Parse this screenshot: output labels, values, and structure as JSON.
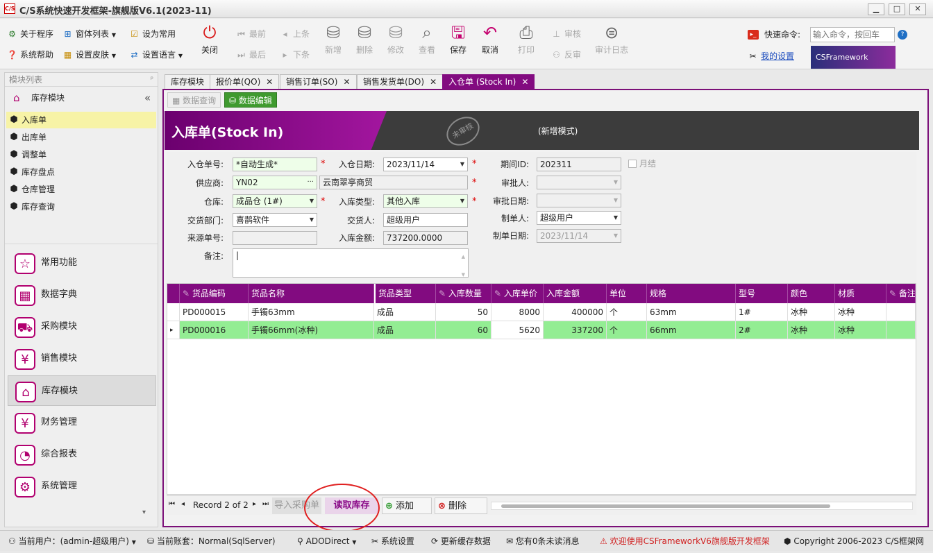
{
  "window": {
    "icon_text": "C/S",
    "title": "C/S系统快速开发框架-旗舰版V6.1(2023-11)",
    "min": "▁",
    "max": "□",
    "close": "✕"
  },
  "ribbon": {
    "about": "关于程序",
    "window_list": "窗体列表",
    "set_common": "设为常用",
    "help": "系统帮助",
    "skin": "设置皮肤",
    "language": "设置语言",
    "close": "关闭",
    "first": "最前",
    "prev": "上条",
    "last": "最后",
    "next": "下条",
    "add": "新增",
    "delete": "删除",
    "edit": "修改",
    "view": "查看",
    "save": "保存",
    "cancel": "取消",
    "print": "打印",
    "approve": "审核",
    "unapprove": "反审",
    "audit_log": "审计日志",
    "quick_cmd_label": "快速命令:",
    "quick_cmd_placeholder": "输入命令，按回车",
    "my_settings": "我的设置",
    "brand": "CSFramework"
  },
  "left": {
    "header": "模块列表",
    "pin": "ᵖ",
    "module_title": "库存模块",
    "collapse": "«",
    "tree": [
      "入库单",
      "出库单",
      "调整单",
      "库存盘点",
      "仓库管理",
      "库存查询"
    ],
    "nav": [
      {
        "label": "常用功能",
        "icon": "☆"
      },
      {
        "label": "数据字典",
        "icon": "▦"
      },
      {
        "label": "采购模块",
        "icon": "⛟"
      },
      {
        "label": "销售模块",
        "icon": "¥"
      },
      {
        "label": "库存模块",
        "icon": "⌂"
      },
      {
        "label": "财务管理",
        "icon": "¥"
      },
      {
        "label": "综合报表",
        "icon": "◔"
      },
      {
        "label": "系统管理",
        "icon": "⚙"
      }
    ],
    "scroll_down": "▾"
  },
  "tabs": [
    {
      "label": "库存模块",
      "close": ""
    },
    {
      "label": "报价单(QO)",
      "close": "✕"
    },
    {
      "label": "销售订单(SO)",
      "close": "✕"
    },
    {
      "label": "销售发货单(DO)",
      "close": "✕"
    },
    {
      "label": "入仓单 (Stock In)",
      "close": "✕"
    }
  ],
  "subtabs": {
    "query": "数据查询",
    "edit": "数据编辑"
  },
  "header": {
    "title": "入库单(Stock In)",
    "stamp": "未审核",
    "mode": "(新增模式)"
  },
  "form": {
    "order_no_label": "入仓单号:",
    "order_no": "*自动生成*",
    "date_label": "入仓日期:",
    "date": "2023/11/14",
    "period_label": "期间ID:",
    "period": "202311",
    "month_end_label": "月结",
    "supplier_label": "供应商:",
    "supplier_code": "YN02",
    "supplier_name": "云南翠亭商贸",
    "approver_label": "审批人:",
    "approver": "",
    "warehouse_label": "仓库:",
    "warehouse": "成品仓 (1#)",
    "in_type_label": "入库类型:",
    "in_type": "其他入库",
    "approve_date_label": "审批日期:",
    "approve_date": "",
    "dept_label": "交货部门:",
    "dept": "喜鹊软件",
    "deliverer_label": "交货人:",
    "deliverer": "超级用户",
    "maker_label": "制单人:",
    "maker": "超级用户",
    "source_no_label": "来源单号:",
    "source_no": "",
    "amount_label": "入库金额:",
    "amount": "737200.0000",
    "make_date_label": "制单日期:",
    "make_date": "2023/11/14",
    "remark_label": "备注:",
    "remark": "|"
  },
  "grid": {
    "columns": [
      "货品编码",
      "货品名称",
      "货品类型",
      "入库数量",
      "入库单价",
      "入库金额",
      "单位",
      "规格",
      "型号",
      "颜色",
      "材质",
      "备注"
    ],
    "rows": [
      {
        "indicator": "",
        "code": "PD000015",
        "name": "手镯63mm",
        "type": "成品",
        "qty": "50",
        "price": "8000",
        "amount": "400000",
        "unit": "个",
        "spec": "63mm",
        "model": "1#",
        "color": "冰种",
        "material": "冰种",
        "remark": ""
      },
      {
        "indicator": "▸",
        "code": "PD000016",
        "name": "手镯66mm(冰种)",
        "type": "成品",
        "qty": "60",
        "price": "5620",
        "amount": "337200",
        "unit": "个",
        "spec": "66mm",
        "model": "2#",
        "color": "冰种",
        "material": "冰种",
        "remark": ""
      }
    ]
  },
  "bottom": {
    "first": "⏮",
    "prev": "◂",
    "record": "Record 2 of 2",
    "next": "▸",
    "last": "⏭",
    "import_po": "导入采购单",
    "read_stock": "读取库存",
    "add": "添加",
    "delete": "删除"
  },
  "status": {
    "user": "当前用户：(admin-超级用户)",
    "account": "当前账套：Normal(SqlServer)",
    "conn": "ADODirect",
    "settings": "系统设置",
    "refresh": "更新缓存数据",
    "messages": "您有0条未读消息",
    "welcome": "欢迎使用CSFrameworkV6旗舰版开发框架",
    "copyright": "Copyright 2006-2023 C/S框架网"
  },
  "colors": {
    "accent": "#820b80",
    "selected_row": "#93ed93",
    "annotation": "#e02020"
  }
}
